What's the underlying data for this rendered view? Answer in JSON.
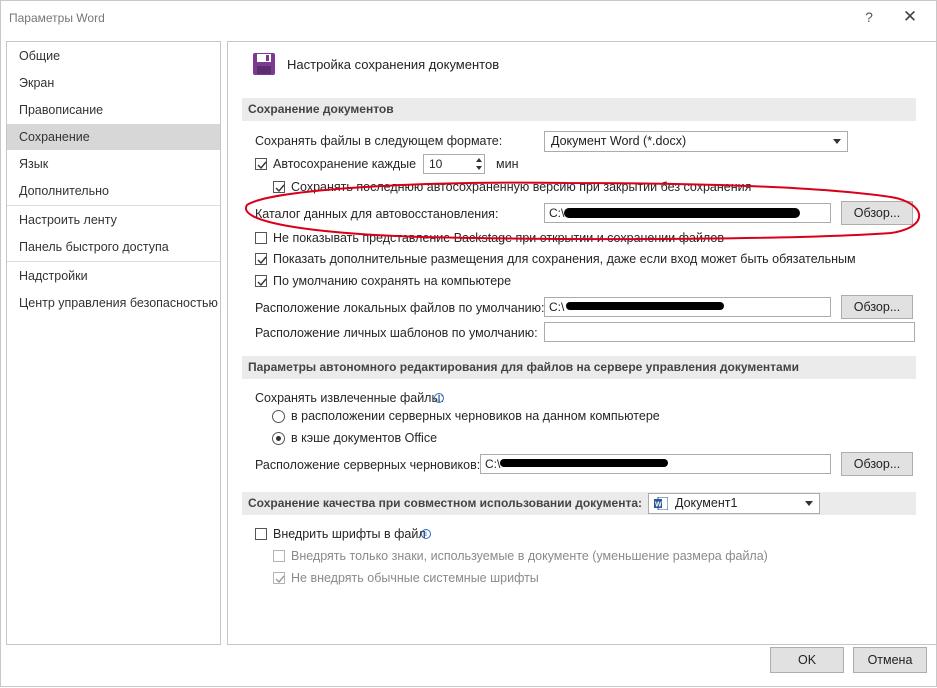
{
  "window": {
    "title": "Параметры Word",
    "help_glyph": "?",
    "close_glyph": "✕"
  },
  "nav": {
    "items": [
      {
        "label": "Общие"
      },
      {
        "label": "Экран"
      },
      {
        "label": "Правописание"
      },
      {
        "label": "Сохранение",
        "active": true
      },
      {
        "label": "Язык"
      },
      {
        "label": "Дополнительно"
      },
      {
        "label": "Настроить ленту"
      },
      {
        "label": "Панель быстрого доступа"
      },
      {
        "label": "Надстройки"
      },
      {
        "label": "Центр управления безопасностью"
      }
    ]
  },
  "main": {
    "header_title": "Настройка сохранения документов",
    "save_section": {
      "title": "Сохранение документов",
      "format_label": "Сохранять файлы в следующем формате:",
      "format_value": "Документ Word (*.docx)",
      "autosave_label": "Автосохранение каждые",
      "autosave_checked": true,
      "autosave_value": "10",
      "autosave_unit": "мин",
      "keep_last_label": "Сохранять последнюю автосохраненную версию при закрытии без сохранения",
      "keep_last_checked": true,
      "autorecover_label": "Каталог данных для автовосстановления:",
      "autorecover_value": "C:\\",
      "browse1": "Обзор...",
      "no_backstage_label": "Не показывать представление Backstage при открытии и сохранении файлов",
      "no_backstage_checked": false,
      "show_more_label": "Показать дополнительные размещения для сохранения, даже если вход может быть обязательным",
      "show_more_checked": true,
      "default_computer_label": "По умолчанию сохранять на компьютере",
      "default_computer_checked": true,
      "local_files_label": "Расположение локальных файлов по умолчанию:",
      "local_files_value": "C:\\",
      "browse2": "Обзор...",
      "templates_label": "Расположение личных шаблонов по умолчанию:",
      "templates_value": ""
    },
    "offline_section": {
      "title": "Параметры автономного редактирования для файлов на сервере управления документами",
      "save_extracted_label": "Сохранять извлеченные файлы:",
      "radio1_label": "в расположении серверных черновиков на данном компьютере",
      "radio1_checked": false,
      "radio2_label": "в кэше документов Office",
      "radio2_checked": true,
      "drafts_label": "Расположение серверных черновиков:",
      "drafts_value": "C:\\",
      "browse3": "Обзор..."
    },
    "quality_section": {
      "title": "Сохранение качества при совместном использовании документа:",
      "document_value": "Документ1",
      "embed_fonts_label": "Внедрить шрифты в файл",
      "embed_fonts_checked": false,
      "only_used_label": "Внедрять только знаки, используемые в документе (уменьшение размера файла)",
      "only_used_checked": false,
      "no_common_label": "Не внедрять обычные системные шрифты",
      "no_common_checked": true
    }
  },
  "footer": {
    "ok": "OK",
    "cancel": "Отмена"
  },
  "colors": {
    "annotation": "#d9001b",
    "save_icon": "#7a3b91",
    "active_nav": "#d7d7d7",
    "section_bg": "#ebebeb"
  }
}
